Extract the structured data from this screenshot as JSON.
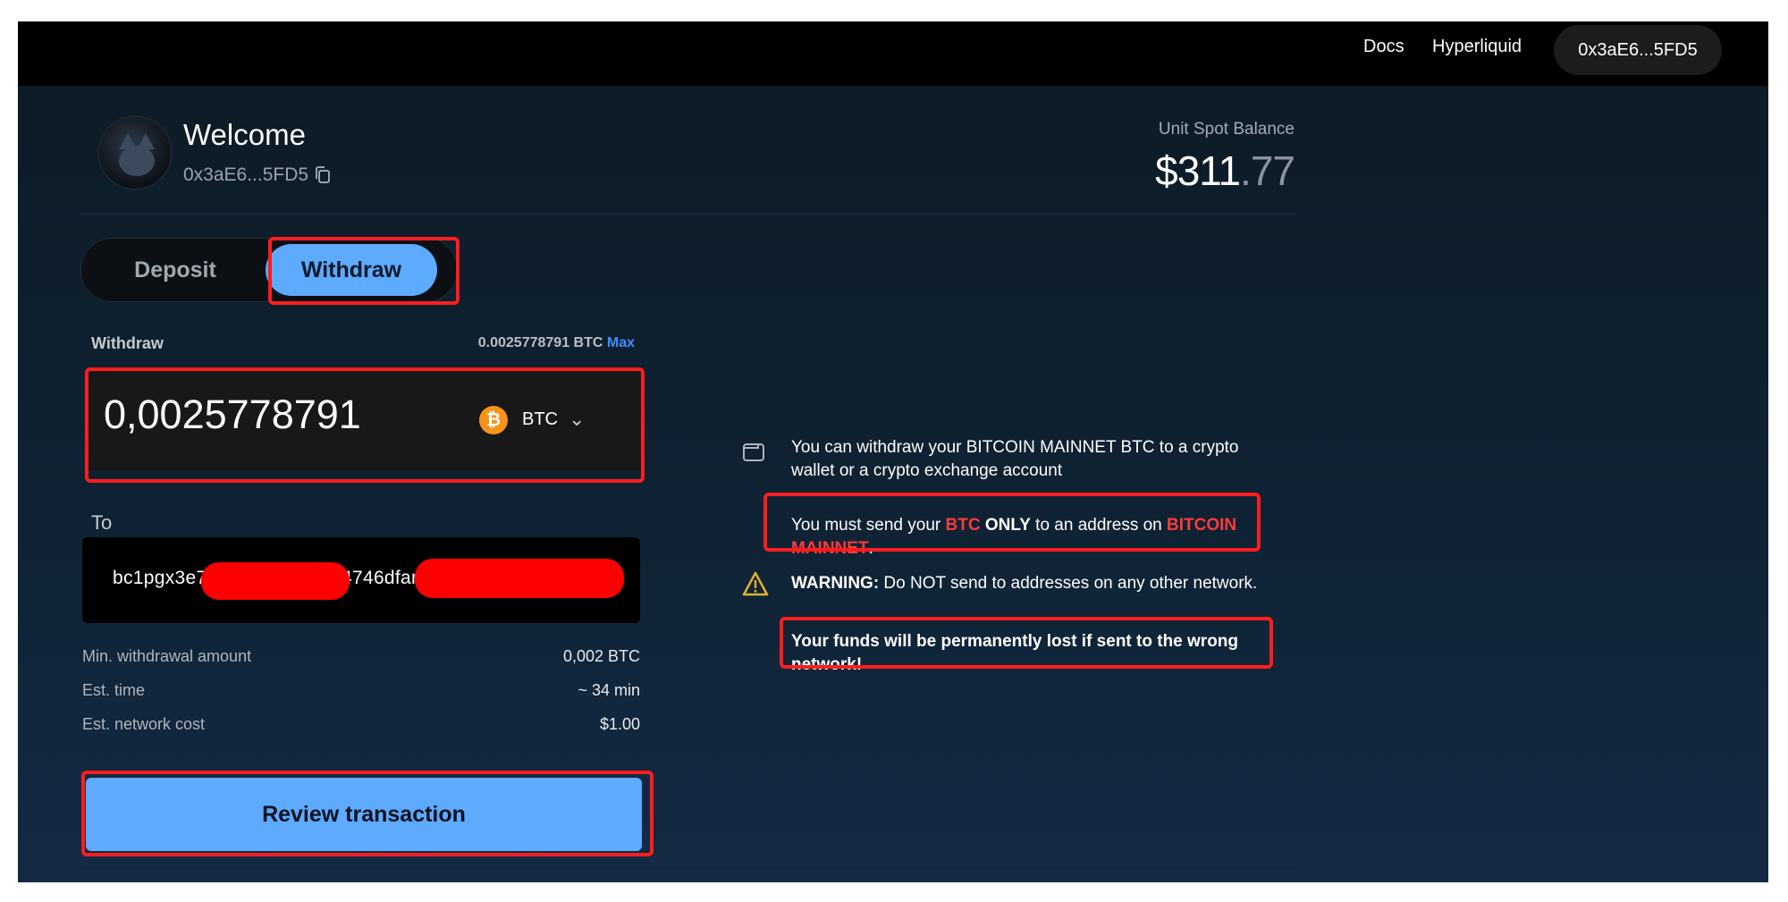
{
  "topbar": {
    "docs": "Docs",
    "hyperliquid": "Hyperliquid",
    "wallet": "0x3aE6...5FD5"
  },
  "profile": {
    "welcome": "Welcome",
    "address": "0x3aE6...5FD5"
  },
  "balance": {
    "label": "Unit Spot Balance",
    "whole": "$311",
    "decimal": ".77"
  },
  "tabs": {
    "deposit": "Deposit",
    "withdraw": "Withdraw",
    "active": "withdraw"
  },
  "withdraw": {
    "label": "Withdraw",
    "available": "0.0025778791 BTC",
    "max": "Max",
    "amount": "0,0025778791",
    "asset": "BTC",
    "asset_icon": "bitcoin-icon"
  },
  "to": {
    "label": "To",
    "address_part1": "bc1pgx3e7",
    "address_part2": "4746dfar"
  },
  "details": [
    {
      "label": "Min. withdrawal amount",
      "value": "0,002 BTC"
    },
    {
      "label": "Est. time",
      "value": "~ 34 min"
    },
    {
      "label": "Est. network cost",
      "value": "$1.00"
    }
  ],
  "review_button": "Review transaction",
  "notes": {
    "info": "You can withdraw your BITCOIN MAINNET BTC to a crypto wallet or a crypto exchange account",
    "must_1": "You must send your ",
    "must_btc": "BTC",
    "must_only": " ONLY",
    "must_2": " to an address on ",
    "must_network": "BITCOIN MAINNET",
    "must_end": ".",
    "warning_label": "WARNING:",
    "warning_text": " Do NOT send to addresses on any other network.",
    "lost": "Your funds will be permanently lost if sent to the wrong network!"
  },
  "colors": {
    "accent": "#5eaaff",
    "danger": "#ff3a3a",
    "highlight_box": "#ff1d1d",
    "bitcoin": "#f7931a",
    "warning": "#e0b12e"
  }
}
